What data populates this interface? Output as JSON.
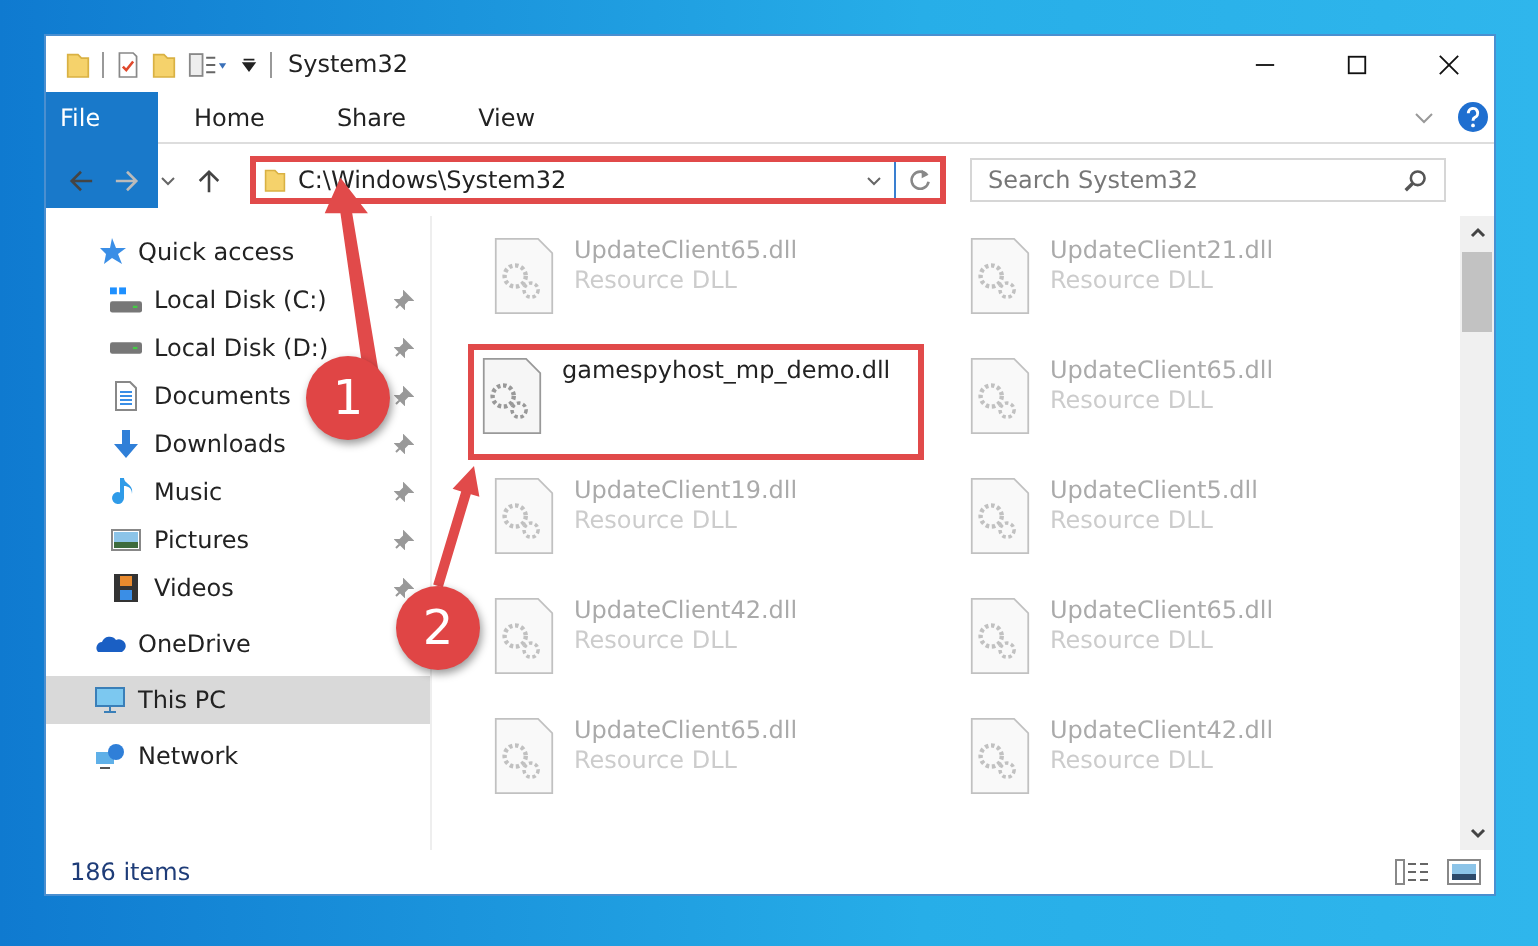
{
  "window": {
    "title": "System32"
  },
  "ribbon_tabs": [
    {
      "label": "File",
      "kind": "file"
    },
    {
      "label": "Home",
      "kind": "tab"
    },
    {
      "label": "Share",
      "kind": "tab"
    },
    {
      "label": "View",
      "kind": "tab"
    }
  ],
  "address_bar": {
    "path": "C:\\Windows\\System32",
    "highlighted": true
  },
  "search": {
    "placeholder": "Search System32"
  },
  "sidebar": {
    "items": [
      {
        "label": "Quick access",
        "selected": false,
        "children": [
          {
            "label": "Local Disk (C:)",
            "pinned": true,
            "selected": false
          },
          {
            "label": "Local Disk (D:)",
            "pinned": true,
            "selected": false
          },
          {
            "label": "Documents",
            "pinned": true,
            "selected": false
          },
          {
            "label": "Downloads",
            "pinned": true,
            "selected": false
          },
          {
            "label": "Music",
            "pinned": true,
            "selected": false
          },
          {
            "label": "Pictures",
            "pinned": true,
            "selected": false
          },
          {
            "label": "Videos",
            "pinned": true,
            "selected": false
          }
        ]
      },
      {
        "label": "OneDrive",
        "selected": false
      },
      {
        "label": "This PC",
        "selected": true
      },
      {
        "label": "Network",
        "selected": false
      }
    ]
  },
  "files": [
    {
      "name": "UpdateClient65.dll",
      "type": "Resource DLL",
      "blurred": true,
      "highlighted": false
    },
    {
      "name": "UpdateClient21.dll",
      "type": "Resource DLL",
      "blurred": true,
      "highlighted": false
    },
    {
      "name": "gamespyhost_mp_demo.dll",
      "blurred": false,
      "highlighted": true
    },
    {
      "name": "UpdateClient65.dll",
      "type": "Resource DLL",
      "blurred": true,
      "highlighted": false
    },
    {
      "name": "UpdateClient19.dll",
      "type": "Resource DLL",
      "blurred": true,
      "highlighted": false
    },
    {
      "name": "UpdateClient5.dll",
      "type": "Resource DLL",
      "blurred": true,
      "highlighted": false
    },
    {
      "name": "UpdateClient42.dll",
      "type": "Resource DLL",
      "blurred": true,
      "highlighted": false
    },
    {
      "name": "UpdateClient65.dll",
      "type": "Resource DLL",
      "blurred": true,
      "highlighted": false
    },
    {
      "name": "UpdateClient65.dll",
      "type": "Resource DLL",
      "blurred": true,
      "highlighted": false
    },
    {
      "name": "UpdateClient42.dll",
      "type": "Resource DLL",
      "blurred": true,
      "highlighted": false
    }
  ],
  "status_bar": {
    "item_count": "186 items"
  },
  "callouts": [
    {
      "number": "1"
    },
    {
      "number": "2"
    }
  ]
}
